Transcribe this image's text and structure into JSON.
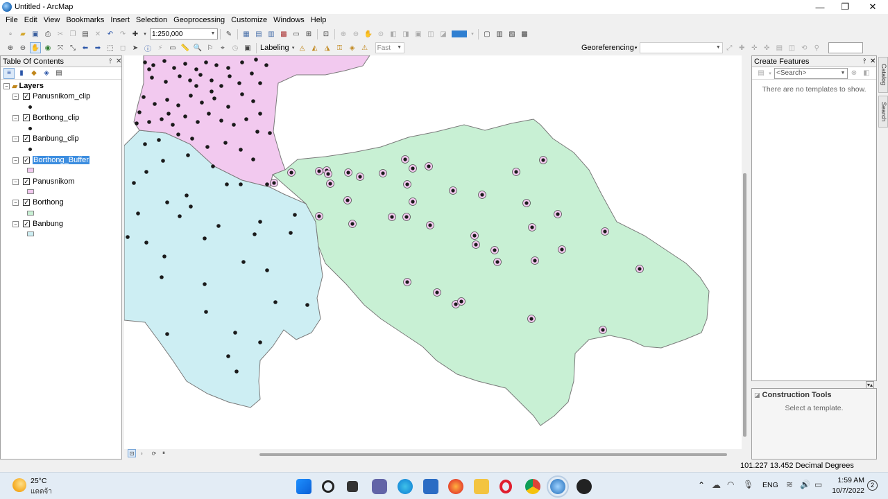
{
  "window": {
    "title": "Untitled - ArcMap",
    "minimize": "—",
    "maximize": "❐",
    "close": "✕"
  },
  "menu": [
    "File",
    "Edit",
    "View",
    "Bookmarks",
    "Insert",
    "Selection",
    "Geoprocessing",
    "Customize",
    "Windows",
    "Help"
  ],
  "toolbar": {
    "scale": "1:250,000",
    "labeling": "Labeling",
    "quality": "Fast",
    "georeferencing": "Georeferencing"
  },
  "toc": {
    "title": "Table Of Contents",
    "root": "Layers",
    "layers": [
      {
        "name": "Panusnikom_clip",
        "symbol": "point",
        "checked": true,
        "selected": false
      },
      {
        "name": "Borthong_clip",
        "symbol": "point",
        "checked": true,
        "selected": false
      },
      {
        "name": "Banbung_clip",
        "symbol": "point",
        "checked": true,
        "selected": false
      },
      {
        "name": "Borthong_Buffer",
        "symbol": "polygon",
        "color": "#f2c9ef",
        "checked": true,
        "selected": true
      },
      {
        "name": "Panusnikom",
        "symbol": "polygon",
        "color": "#f2c9ef",
        "checked": true,
        "selected": false
      },
      {
        "name": "Borthong",
        "symbol": "polygon",
        "color": "#c8f0d4",
        "checked": true,
        "selected": false
      },
      {
        "name": "Banbung",
        "symbol": "polygon",
        "color": "#cdeef3",
        "checked": true,
        "selected": false
      }
    ]
  },
  "create_features": {
    "title": "Create Features",
    "search_placeholder": "<Search>",
    "empty_message": "There are no templates to show."
  },
  "construction_tools": {
    "title": "Construction Tools",
    "message": "Select a template."
  },
  "side_tabs": [
    "Catalog",
    "Search"
  ],
  "status": {
    "coordinates": "101.227  13.452 Decimal Degrees"
  },
  "taskbar": {
    "temperature": "25°C",
    "weather": "แดดจ้า",
    "language": "ENG",
    "time": "1:59 AM",
    "date": "10/7/2022",
    "notifications": "2"
  },
  "colors": {
    "panusnikom_fill": "#f2c9ef",
    "borthong_fill": "#c8f0d4",
    "banbung_fill": "#cdeef3",
    "selection": "#3d8ee0"
  }
}
